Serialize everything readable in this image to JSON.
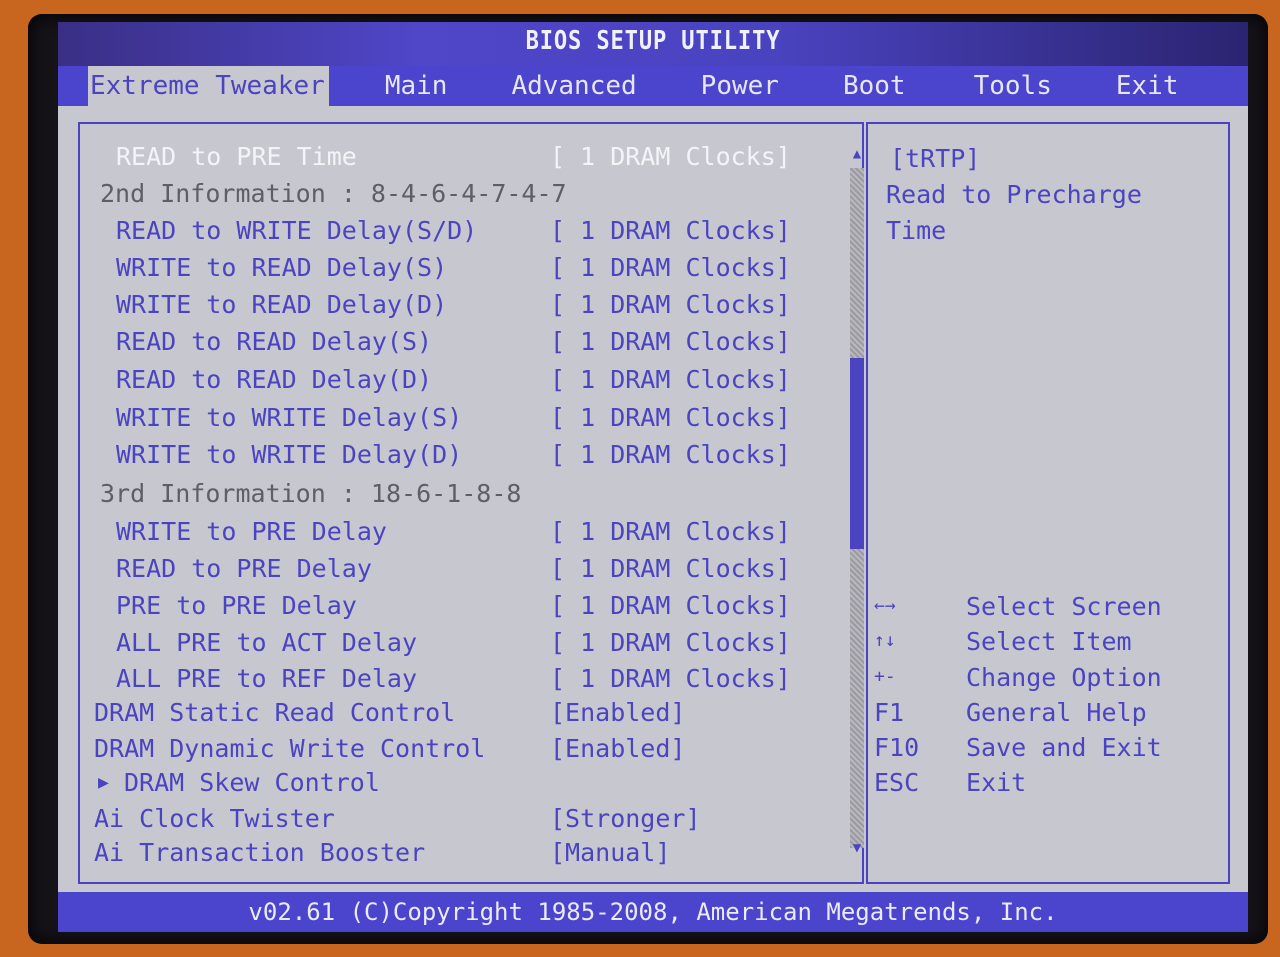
{
  "title": "BIOS SETUP UTILITY",
  "tabs": [
    {
      "label": "Extreme Tweaker",
      "active": true
    },
    {
      "label": "Main",
      "active": false
    },
    {
      "label": "Advanced",
      "active": false
    },
    {
      "label": "Power",
      "active": false
    },
    {
      "label": "Boot",
      "active": false
    },
    {
      "label": "Tools",
      "active": false
    },
    {
      "label": "Exit",
      "active": false
    }
  ],
  "settings": [
    {
      "label": "READ to PRE Time",
      "value": "[ 1 DRAM Clocks]",
      "type": "selected"
    },
    {
      "label": "2nd Information : 8-4-6-4-7-4-7",
      "value": "",
      "type": "info"
    },
    {
      "label": "READ to WRITE Delay(S/D)",
      "value": "[ 1 DRAM Clocks]",
      "type": "item"
    },
    {
      "label": "WRITE to READ Delay(S)",
      "value": "[ 1 DRAM Clocks]",
      "type": "item"
    },
    {
      "label": "WRITE to READ Delay(D)",
      "value": "[ 1 DRAM Clocks]",
      "type": "item"
    },
    {
      "label": "READ to READ Delay(S)",
      "value": "[ 1 DRAM Clocks]",
      "type": "item"
    },
    {
      "label": "READ to READ Delay(D)",
      "value": "[ 1 DRAM Clocks]",
      "type": "item"
    },
    {
      "label": "WRITE to WRITE Delay(S)",
      "value": "[ 1 DRAM Clocks]",
      "type": "item"
    },
    {
      "label": "WRITE to WRITE Delay(D)",
      "value": "[ 1 DRAM Clocks]",
      "type": "item"
    },
    {
      "label": "3rd Information : 18-6-1-8-8",
      "value": "",
      "type": "info"
    },
    {
      "label": "WRITE to PRE Delay",
      "value": "[ 1 DRAM Clocks]",
      "type": "item"
    },
    {
      "label": "READ to PRE Delay",
      "value": "[ 1 DRAM Clocks]",
      "type": "item"
    },
    {
      "label": "PRE to PRE Delay",
      "value": "[ 1 DRAM Clocks]",
      "type": "item"
    },
    {
      "label": "ALL PRE to ACT Delay",
      "value": "[ 1 DRAM Clocks]",
      "type": "item"
    },
    {
      "label": "ALL PRE to REF Delay",
      "value": "[ 1 DRAM Clocks]",
      "type": "item"
    },
    {
      "label": "DRAM Static Read Control",
      "value": "[Enabled]",
      "type": "top"
    },
    {
      "label": "DRAM Dynamic Write Control",
      "value": "[Enabled]",
      "type": "top"
    },
    {
      "label": "DRAM Skew Control",
      "value": "",
      "type": "submenu"
    },
    {
      "label": "Ai Clock Twister",
      "value": "[Stronger]",
      "type": "top"
    },
    {
      "label": "Ai Transaction Booster",
      "value": "[Manual]",
      "type": "top"
    }
  ],
  "submenu_arrow": "▶",
  "scrollbar": {
    "up_arrow": "▲",
    "down_arrow": "▼",
    "thumb_start": 0.28,
    "thumb_end": 0.56
  },
  "help": {
    "lines": [
      "[tRTP]",
      "Read to Precharge",
      "Time"
    ]
  },
  "keys": [
    {
      "key": "←→",
      "desc": "Select Screen"
    },
    {
      "key": "↑↓",
      "desc": "Select Item"
    },
    {
      "key": "+-",
      "desc": "Change Option"
    },
    {
      "key": "F1",
      "desc": "General Help"
    },
    {
      "key": "F10",
      "desc": "Save and Exit"
    },
    {
      "key": "ESC",
      "desc": "Exit"
    }
  ],
  "footer": "v02.61 (C)Copyright 1985-2008, American Megatrends, Inc.",
  "colors": {
    "accent": "#4a44c0",
    "background": "#c7c8cf",
    "selected_text": "#f4f4f8",
    "info_text": "#5e5e66"
  }
}
